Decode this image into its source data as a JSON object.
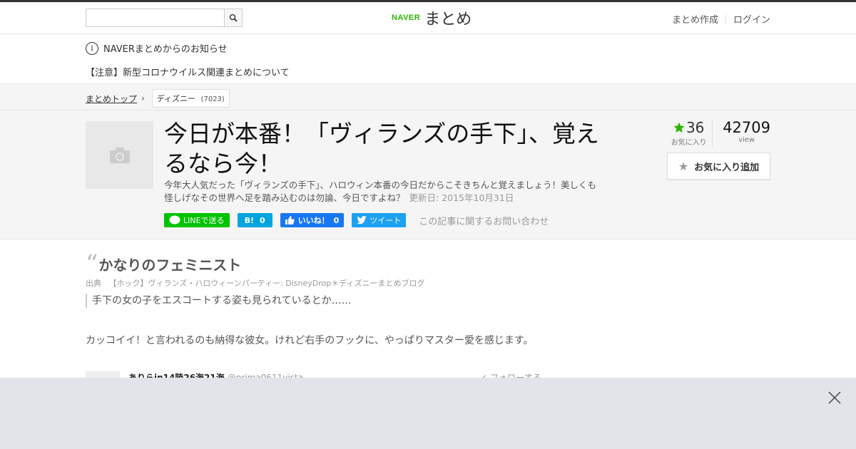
{
  "header": {
    "search_placeholder": "",
    "search_icon": "search-icon",
    "logo_naver": "NAVER",
    "logo_matome": "まとめ",
    "nav_create": "まとめ作成",
    "nav_login": "ログイン"
  },
  "notice": {
    "info_icon_glyph": "i",
    "title": "NAVERまとめからのお知らせ",
    "item": "【注意】新型コロナウイルス関連まとめについて"
  },
  "breadcrumb": {
    "top": "まとめトップ",
    "tag": "ディズニー",
    "tag_count": "(7023)"
  },
  "article": {
    "title": "今日が本番！「ヴィランズの手下」、覚えるなら今！",
    "description": "今年大人気だった「ヴィランズの手下」、ハロウィン本番の今日だからこそきちんと覚えましょう！美しくも怪しげなその世界へ足を踏み込むのは勿論、今日ですよね？",
    "updated": "更新日: 2015年10月31日",
    "share_line": "LINEで送る",
    "share_hatena": "B!",
    "share_hatena_count": "0",
    "share_fb": "いいね！",
    "share_fb_count": "0",
    "share_tweet": "ツイート",
    "contact": "この記事に関するお問い合わせ",
    "fav_count": "36",
    "fav_label": "お気に入り",
    "view_count": "42709",
    "view_label": "view",
    "fav_button": "お気に入り追加"
  },
  "content": {
    "quote_mark": "“",
    "quote_title": "かなりのフェミニスト",
    "source_label": "出典",
    "source_text": "【ホック】ヴィランズ・ハロウィーンパーティー: DisneyDrop＊ディズニーまとめブログ",
    "quote_body": "手下の女の子をエスコートする姿も見られているとか……",
    "paragraph": "カッコイイ！と言われるのも納得な彼女。けれど右手のフックに、やっぱりマスター愛を感じます。",
    "tweet_name": "ありらin14陸26海21海",
    "tweet_handle": "@prima0611vista",
    "tweet_follow": "フォローする"
  },
  "colors": {
    "accent_green": "#2db400",
    "line": "#00c300",
    "hatena": "#00a4de",
    "facebook": "#1877f2",
    "twitter": "#1da1f2",
    "overlay": "#e1e4e8"
  }
}
